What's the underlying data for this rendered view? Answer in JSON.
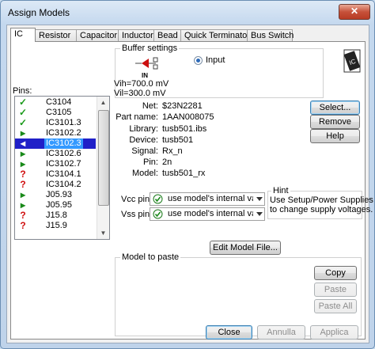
{
  "window": {
    "title": "Assign Models",
    "close_glyph": "✕"
  },
  "tabs": [
    {
      "label": "IC",
      "active": true
    },
    {
      "label": "Resistor"
    },
    {
      "label": "Capacitor"
    },
    {
      "label": "Inductor"
    },
    {
      "label": "Bead"
    },
    {
      "label": "Quick Terminator"
    },
    {
      "label": "Bus Switch"
    }
  ],
  "pins": {
    "label": "Pins:",
    "items": [
      {
        "name": "C3104",
        "icon": "check-icon",
        "color": "#1a9a1a"
      },
      {
        "name": "C3105",
        "icon": "check-icon",
        "color": "#1a9a1a"
      },
      {
        "name": "IC3101.3",
        "icon": "check-icon",
        "color": "#1a9a1a"
      },
      {
        "name": "IC3102.2",
        "icon": "output-driver-icon",
        "color": "#1a8a1a"
      },
      {
        "name": "IC3102.3",
        "icon": "input-receiver-icon",
        "color": "#1a8a1a",
        "selected": true
      },
      {
        "name": "IC3102.6",
        "icon": "output-driver-icon",
        "color": "#1a8a1a"
      },
      {
        "name": "IC3102.7",
        "icon": "output-driver-icon",
        "color": "#1a8a1a"
      },
      {
        "name": "IC3104.1",
        "icon": "question-icon",
        "color": "#d01010"
      },
      {
        "name": "IC3104.2",
        "icon": "question-icon",
        "color": "#d01010"
      },
      {
        "name": "J05.93",
        "icon": "output-driver-icon",
        "color": "#1a8a1a"
      },
      {
        "name": "J05.95",
        "icon": "output-driver-icon",
        "color": "#1a8a1a"
      },
      {
        "name": "J15.8",
        "icon": "question-icon",
        "color": "#d01010"
      },
      {
        "name": "J15.9",
        "icon": "question-icon",
        "color": "#d01010"
      }
    ]
  },
  "buffer": {
    "group_title": "Buffer settings",
    "in_label": "IN",
    "mode": "Input",
    "vih": "Vih=700.0 mV",
    "vil": "Vil=300.0 mV"
  },
  "info": {
    "net_label": "Net:",
    "net": "$23N2281",
    "part_label": "Part name:",
    "part": "1AAN008075",
    "library_label": "Library:",
    "library": "tusb501.ibs",
    "device_label": "Device:",
    "device": "tusb501",
    "signal_label": "Signal:",
    "signal": "Rx_n",
    "pin_label": "Pin:",
    "pin": "2n",
    "model_label": "Model:",
    "model": "tusb501_rx"
  },
  "buttons": {
    "select": "Select...",
    "remove": "Remove",
    "help": "Help",
    "edit_model": "Edit Model File...",
    "copy": "Copy",
    "paste": "Paste",
    "paste_all": "Paste All",
    "close": "Close",
    "cancel": "Annulla",
    "apply": "Applica"
  },
  "power": {
    "vcc_label": "Vcc pin:",
    "vcc_value": "use model's internal value",
    "vss_label": "Vss pin:",
    "vss_value": "use model's internal value"
  },
  "hint": {
    "title": "Hint",
    "text_line1": "Use Setup/Power Supplies",
    "text_line2": "to change supply voltages."
  },
  "paste_group": {
    "title": "Model to paste"
  },
  "colors": {
    "selection": "#2020c8",
    "accent": "#3399ff",
    "check": "#1a9a1a",
    "question": "#d01010"
  }
}
